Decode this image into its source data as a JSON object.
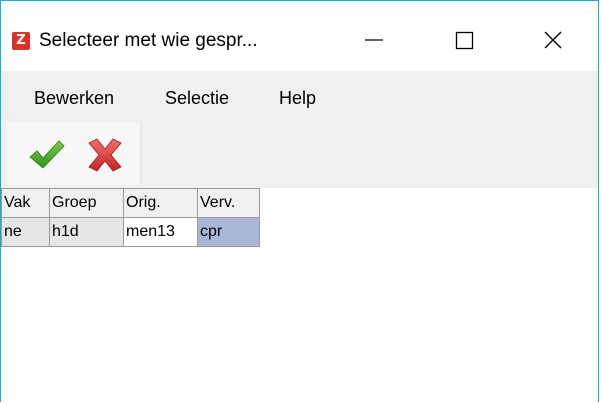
{
  "window": {
    "title": "Selecteer met wie gespr...",
    "app_icon_glyph": "Z",
    "accent_color": "#2aa3cf",
    "controls": {
      "minimize_icon": "minimize-icon",
      "maximize_icon": "maximize-icon",
      "close_icon": "close-icon"
    }
  },
  "menubar": {
    "items": [
      {
        "label": "Bewerken"
      },
      {
        "label": "Selectie"
      },
      {
        "label": "Help"
      }
    ]
  },
  "toolbar": {
    "ok_icon": "checkmark-icon",
    "ok_color": "#3aa82a",
    "cancel_icon": "red-x-icon",
    "cancel_color": "#d23a3a"
  },
  "grid": {
    "columns": [
      "Vak",
      "Groep",
      "Orig.",
      "Verv."
    ],
    "rows": [
      [
        "ne",
        "h1d",
        "men13",
        "cpr"
      ]
    ],
    "selected_color": "#a9b8d6"
  }
}
